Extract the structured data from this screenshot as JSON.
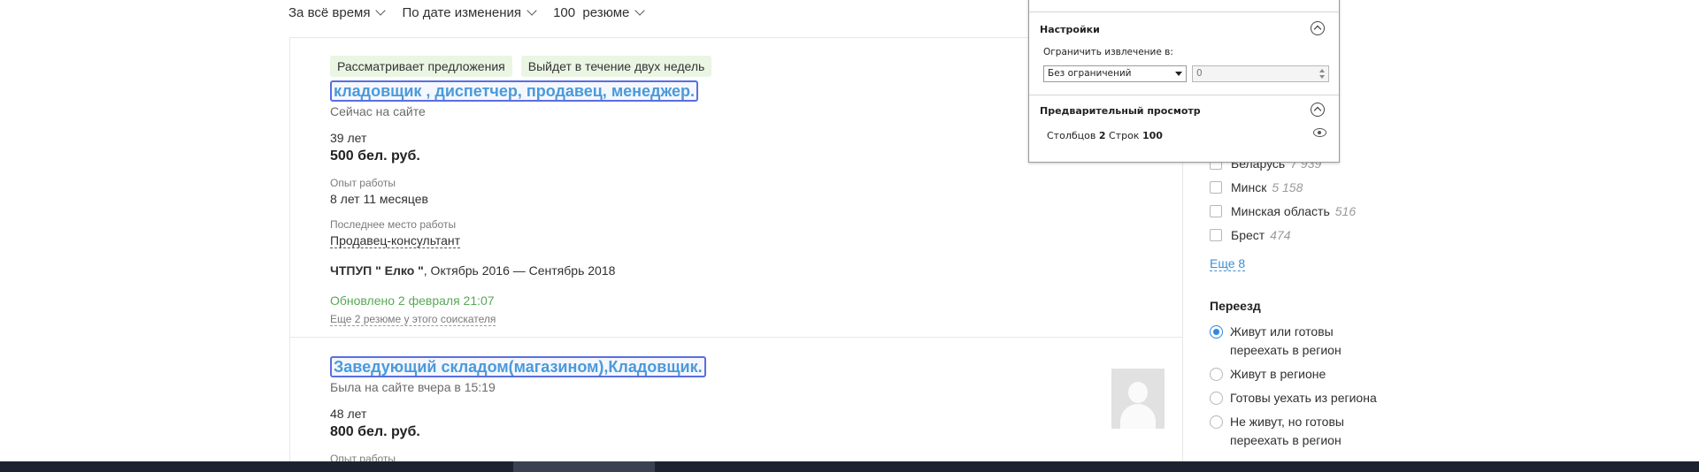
{
  "filters": [
    {
      "label": "За всё время"
    },
    {
      "label": "По дате изменения"
    },
    {
      "label": "100  резюме"
    }
  ],
  "resumes": [
    {
      "tags": [
        "Рассматривает предложения",
        "Выйдет в течение двух недель"
      ],
      "title": "кладовщик , диспетчер, продавец, менеджер.",
      "online": "Сейчас на сайте",
      "age": "39 лет",
      "salary": "500 бел. руб.",
      "experience_label": "Опыт работы",
      "experience": "8 лет 11 месяцев",
      "last_job_label": "Последнее место работы",
      "last_position": "Продавец-консультант",
      "company": "ЧТПУП \" Елко \"",
      "period": ", Октябрь 2016 — Сентябрь 2018",
      "updated": "Обновлено 2 февраля 21:07",
      "more": "Еще 2 резюме у этого соискателя"
    },
    {
      "title": "Заведующий складом(магазином),Кладовщик.",
      "online": "Была на сайте вчера в 15:19",
      "age": "48 лет",
      "salary": "800 бел. руб.",
      "experience_label": "Опыт работы"
    }
  ],
  "sidebar": {
    "regions": [
      {
        "name": "Беларусь",
        "count": "7 939"
      },
      {
        "name": "Минск",
        "count": "5 158"
      },
      {
        "name": "Минская область",
        "count": "516"
      },
      {
        "name": "Брест",
        "count": "474"
      }
    ],
    "show_more": "Еще 8",
    "relocation_title": "Переезд",
    "relocation_options": [
      {
        "line1": "Живут или готовы",
        "line2": "переехать в регион",
        "selected": true
      },
      {
        "line1": "Живут в регионе",
        "line2": "",
        "selected": false
      },
      {
        "line1": "Готовы уехать из региона",
        "line2": "",
        "selected": false
      },
      {
        "line1": "Не живут, но готовы",
        "line2": "переехать в регион",
        "selected": false
      }
    ]
  },
  "dialog": {
    "settings_title": "Настройки",
    "limit_label": "Ограничить извлечение в:",
    "limit_select": "Без ограничений",
    "limit_value": "0",
    "preview_title": "Предварительный просмотр",
    "columns_label": "Столбцов",
    "columns_value": "2",
    "rows_label": "Строк",
    "rows_value": "100"
  },
  "colors": {
    "link": "#4a9adb",
    "highlight_border": "#5a6ee0",
    "updated_green": "#58a854",
    "tag_bg": "#eaf6e3",
    "radio_selected": "#2f88e0"
  },
  "icons": [
    "chevron-down-icon",
    "collapse-up-icon",
    "eye-icon",
    "avatar-placeholder-icon",
    "dropdown-arrow-icon",
    "spinner-up-icon",
    "spinner-down-icon"
  ]
}
